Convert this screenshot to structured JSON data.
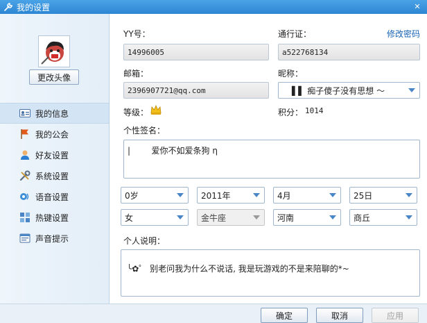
{
  "window": {
    "title": "我的设置",
    "close_glyph": "✕"
  },
  "sidebar": {
    "avatar_button": "更改头像",
    "items": [
      {
        "label": "我的信息",
        "icon": "id-card-icon",
        "active": true
      },
      {
        "label": "我的公会",
        "icon": "flag-icon",
        "active": false
      },
      {
        "label": "好友设置",
        "icon": "friend-icon",
        "active": false
      },
      {
        "label": "系统设置",
        "icon": "tools-icon",
        "active": false
      },
      {
        "label": "语音设置",
        "icon": "voice-icon",
        "active": false
      },
      {
        "label": "热键设置",
        "icon": "hotkey-icon",
        "active": false
      },
      {
        "label": "声音提示",
        "icon": "sound-icon",
        "active": false
      }
    ]
  },
  "profile": {
    "yy_label": "YY号：",
    "yy_value": "14996005",
    "passport_label": "通行证：",
    "passport_value": "a522768134",
    "change_password": "修改密码",
    "email_label": "邮箱：",
    "email_value": "2396907721@qq.com",
    "nickname_label": "昵称：",
    "nickname_value": "▌▌ 痴子傻子没有思想  ～",
    "level_label": "等级：",
    "points_label": "积分：",
    "points_value": "1014",
    "signature_label": "个性签名：",
    "signature_value": "|        爱你不如爱条狗 η",
    "age": "0岁",
    "year": "2011年",
    "month": "4月",
    "day": "25日",
    "gender": "女",
    "zodiac": "金牛座",
    "province": "河南",
    "city": "商丘",
    "description_label": "个人说明：",
    "description_value": "╰✿゜ 别老问我为什么不说话, 我是玩游戏的不是来陪聊的*~"
  },
  "footer": {
    "ok": "确定",
    "cancel": "取消",
    "apply": "应用"
  },
  "colors": {
    "titlebar": "#2d86d3",
    "link": "#1a64b4",
    "sidebar_active": "#d3e4f4"
  }
}
